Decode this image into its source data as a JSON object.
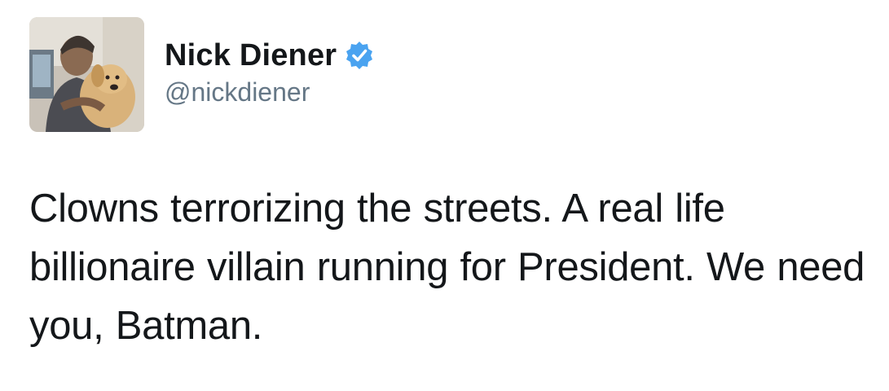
{
  "author": {
    "display_name": "Nick Diener",
    "handle": "@nickdiener",
    "verified": true,
    "verified_color": "#4aa3f0"
  },
  "tweet": {
    "text": "Clowns terrorizing the streets. A real life billionaire villain running for President. We need you, Batman."
  },
  "icons": {
    "avatar": "profile-photo-icon",
    "verified": "verified-badge-icon"
  },
  "colors": {
    "text_primary": "#14171a",
    "text_secondary": "#657786",
    "background": "#ffffff"
  }
}
